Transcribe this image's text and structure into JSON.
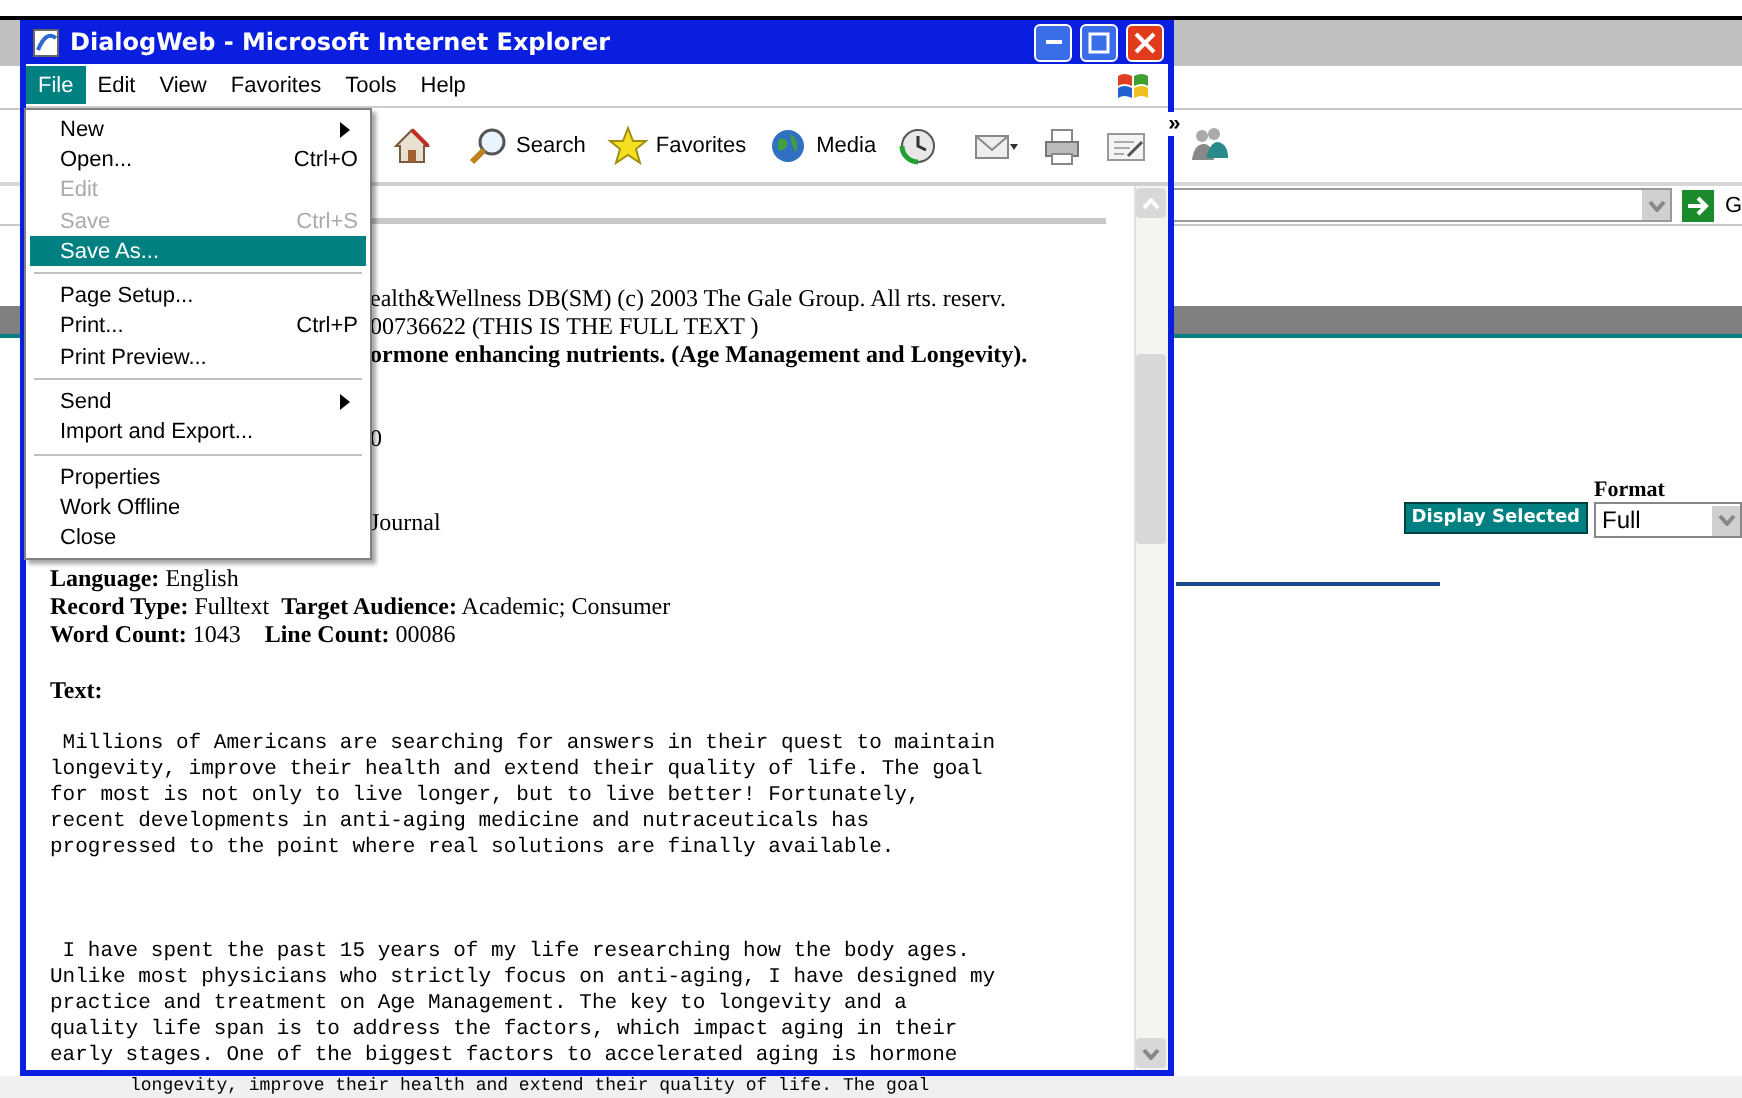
{
  "background_page": {
    "go_label": "G",
    "format_label": "Format",
    "display_button": "Display Selected",
    "format_value": "Full",
    "footer_line": "longevity, improve their health and extend their quality of life. The goal"
  },
  "window": {
    "title": "DialogWeb - Microsoft Internet Explorer"
  },
  "menubar": [
    {
      "label": "File",
      "selected": true
    },
    {
      "label": "Edit",
      "selected": false
    },
    {
      "label": "View",
      "selected": false
    },
    {
      "label": "Favorites",
      "selected": false
    },
    {
      "label": "Tools",
      "selected": false
    },
    {
      "label": "Help",
      "selected": false
    }
  ],
  "toolbar": [
    {
      "kind": "home"
    },
    {
      "kind": "separator"
    },
    {
      "kind": "search",
      "label": "Search"
    },
    {
      "kind": "favorites",
      "label": "Favorites"
    },
    {
      "kind": "media",
      "label": "Media"
    },
    {
      "kind": "history"
    },
    {
      "kind": "separator"
    },
    {
      "kind": "mail"
    },
    {
      "kind": "print"
    },
    {
      "kind": "edit"
    },
    {
      "kind": "more",
      "label": "»"
    }
  ],
  "file_menu": [
    {
      "kind": "item",
      "label": "New",
      "submenu": true,
      "disabled": false,
      "selected": false
    },
    {
      "kind": "item",
      "label": "Open...",
      "shortcut": "Ctrl+O",
      "submenu": false,
      "disabled": false,
      "selected": false
    },
    {
      "kind": "item",
      "label": "Edit",
      "submenu": false,
      "disabled": true,
      "selected": false
    },
    {
      "kind": "item",
      "label": "Save",
      "shortcut": "Ctrl+S",
      "submenu": false,
      "disabled": true,
      "selected": false
    },
    {
      "kind": "item",
      "label": "Save As...",
      "submenu": false,
      "disabled": false,
      "selected": true
    },
    {
      "kind": "separator"
    },
    {
      "kind": "item",
      "label": "Page Setup...",
      "submenu": false,
      "disabled": false,
      "selected": false
    },
    {
      "kind": "item",
      "label": "Print...",
      "shortcut": "Ctrl+P",
      "submenu": false,
      "disabled": false,
      "selected": false
    },
    {
      "kind": "item",
      "label": "Print Preview...",
      "submenu": false,
      "disabled": false,
      "selected": false
    },
    {
      "kind": "separator"
    },
    {
      "kind": "item",
      "label": "Send",
      "submenu": true,
      "disabled": false,
      "selected": false
    },
    {
      "kind": "item",
      "label": "Import and Export...",
      "submenu": false,
      "disabled": false,
      "selected": false
    },
    {
      "kind": "separator"
    },
    {
      "kind": "item",
      "label": "Properties",
      "submenu": false,
      "disabled": false,
      "selected": false
    },
    {
      "kind": "item",
      "label": "Work Offline",
      "submenu": false,
      "disabled": false,
      "selected": false
    },
    {
      "kind": "item",
      "label": "Close",
      "submenu": false,
      "disabled": false,
      "selected": false
    }
  ],
  "record_beside_menu": [
    {
      "kind": "line",
      "text": "ealth&Wellness DB(SM) (c) 2003 The Gale Group. All rts. reserv."
    },
    {
      "kind": "line",
      "text": "00736622 (THIS IS THE FULL TEXT )"
    },
    {
      "kind": "bold_line",
      "text": "ormone enhancing nutrients. (Age Management and Longevity)."
    },
    {
      "kind": "blank"
    },
    {
      "kind": "blank"
    },
    {
      "kind": "line",
      "text": "0"
    },
    {
      "kind": "blank"
    },
    {
      "kind": "blank"
    },
    {
      "kind": "line",
      "text": "Journal"
    }
  ],
  "record": [
    {
      "kind": "blank"
    },
    {
      "kind": "line",
      "text": "**Language:** English"
    },
    {
      "kind": "line",
      "text": "**Record Type:** Fulltext  **Target Audience:** Academic; Consumer"
    },
    {
      "kind": "line",
      "text": "**Word Count:** 1043    **Line Count:** 00086"
    },
    {
      "kind": "blank"
    },
    {
      "kind": "bold_line",
      "text": "Text:"
    }
  ],
  "body_text": [
    {
      "kind": "line",
      "text": " Millions of Americans are searching for answers in their quest to maintain"
    },
    {
      "kind": "line",
      "text": "longevity, improve their health and extend their quality of life. The goal"
    },
    {
      "kind": "line",
      "text": "for most is not only to live longer, but to live better! Fortunately,"
    },
    {
      "kind": "line",
      "text": "recent developments in anti-aging medicine and nutraceuticals has"
    },
    {
      "kind": "line",
      "text": "progressed to the point where real solutions are finally available."
    },
    {
      "kind": "blank"
    },
    {
      "kind": "blank"
    },
    {
      "kind": "blank"
    },
    {
      "kind": "line",
      "text": " I have spent the past 15 years of my life researching how the body ages."
    },
    {
      "kind": "line",
      "text": "Unlike most physicians who strictly focus on anti-aging, I have designed my"
    },
    {
      "kind": "line",
      "text": "practice and treatment on Age Management. The key to longevity and a"
    },
    {
      "kind": "line",
      "text": "quality life span is to address the factors, which impact aging in their"
    },
    {
      "kind": "line",
      "text": "early stages. One of the biggest factors to accelerated aging is hormone"
    }
  ]
}
